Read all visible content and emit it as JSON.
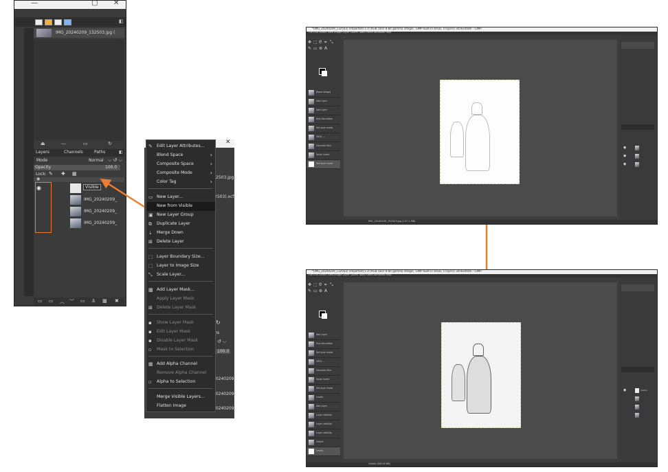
{
  "left_dock": {
    "image_name": "IMG_20240209_132503.jpg (",
    "tabs": {
      "layers": "Layers",
      "channels": "Channels",
      "paths": "Paths"
    },
    "mode_label": "Mode",
    "mode_value": "Normal",
    "opacity_label": "Opacity",
    "opacity_value": "100.0",
    "lock_label": "Lock:",
    "layers": [
      {
        "name": "Visible",
        "visible": true
      },
      {
        "name": "IMG_20240209_",
        "visible": true
      },
      {
        "name": "IMG_20240209_",
        "visible": false
      },
      {
        "name": "IMG_20240209_",
        "visible": false
      }
    ]
  },
  "bg_window": {
    "image_name": "2503.jpg (",
    "xcf_name": "2503).xcf (",
    "paths_tab": "ths",
    "opacity_value": "100.0",
    "layer_rows": [
      "20240209_",
      "20240209_",
      "20240209_"
    ]
  },
  "context_menu": {
    "items": [
      {
        "label": "Edit Layer Attributes...",
        "icon": "edit-icon",
        "disabled": false
      },
      {
        "label": "Blend Space",
        "submenu": true,
        "disabled": false
      },
      {
        "label": "Composite Space",
        "submenu": true,
        "disabled": false
      },
      {
        "label": "Composite Mode",
        "submenu": true,
        "disabled": false
      },
      {
        "label": "Color Tag",
        "submenu": true,
        "disabled": false
      },
      {
        "label": "New Layer...",
        "icon": "new-layer-icon",
        "disabled": false
      },
      {
        "label": "New from Visible",
        "disabled": false,
        "highlighted": true
      },
      {
        "label": "New Layer Group",
        "icon": "folder-icon",
        "disabled": false
      },
      {
        "label": "Duplicate Layer",
        "icon": "duplicate-icon",
        "disabled": false
      },
      {
        "label": "Merge Down",
        "icon": "merge-icon",
        "disabled": false
      },
      {
        "label": "Delete Layer",
        "icon": "delete-icon",
        "disabled": false
      },
      {
        "label": "Layer Boundary Size...",
        "icon": "boundary-icon",
        "disabled": false
      },
      {
        "label": "Layer to Image Size",
        "icon": "fit-icon",
        "disabled": false
      },
      {
        "label": "Scale Layer...",
        "icon": "scale-icon",
        "disabled": false
      },
      {
        "label": "Add Layer Mask...",
        "icon": "mask-icon",
        "disabled": false
      },
      {
        "label": "Apply Layer Mask",
        "disabled": true
      },
      {
        "label": "Delete Layer Mask",
        "icon": "delete-icon",
        "disabled": true
      },
      {
        "label": "Show Layer Mask",
        "icon": "checkbox-icon",
        "disabled": true
      },
      {
        "label": "Edit Layer Mask",
        "icon": "checkbox-icon",
        "disabled": true
      },
      {
        "label": "Disable Layer Mask",
        "icon": "checkbox-icon",
        "disabled": true
      },
      {
        "label": "Mask to Selection",
        "icon": "selection-icon",
        "disabled": true
      },
      {
        "label": "Add Alpha Channel",
        "icon": "alpha-icon",
        "disabled": false
      },
      {
        "label": "Remove Alpha Channel",
        "disabled": true
      },
      {
        "label": "Alpha to Selection",
        "icon": "selection-icon",
        "disabled": false
      },
      {
        "label": "Merge Visible Layers...",
        "disabled": false
      },
      {
        "label": "Flatten Image",
        "disabled": false
      }
    ]
  },
  "gimp_top": {
    "title": "*[IMG_20240209_132503] (imported)-1.0 (RGB color 8-bit gamma integer, GIMP built-in sRGB, 4 layers) 3456x4608 – GIMP",
    "menubar": "File  Edit  Select  View  Image  Layer  Colors  Tools  Filters  Windows  Help",
    "status": "IMG_20240209_132503.jpg (137.1 MB)",
    "history": [
      "[Base Image]",
      "Add Layer",
      "Add Layer",
      "Hue-Saturation",
      "Set layer mode",
      "GEGL ...",
      "Gaussian Blur",
      "Value Invert",
      "Set layer mode"
    ]
  },
  "gimp_bottom": {
    "title": "*[IMG_20240209_132503] (imported)-1.0 (RGB color 8-bit gamma integer, GIMP built-in sRGB, 5 layers) 3456x4608 – GIMP",
    "menubar": "File  Edit  Select  View  Image  Layer  Colors  Tools  Filters  Windows  Help",
    "status": "Visible (563.6 MB)",
    "history": [
      "Add Layer",
      "Hue-Saturation",
      "Set layer mode",
      "GEGL ...",
      "Gaussian Blur",
      "Value Invert",
      "Set layer mode",
      "Levels",
      "Add Layer",
      "Layer visibility",
      "Layer visibility",
      "Layer visibility",
      "Visible",
      "Levels"
    ],
    "top_layer": "Visible"
  },
  "colors": {
    "arrow": "#ed7d31",
    "dark_bg": "#3b3b3b",
    "canvas": "#4b4b4b"
  }
}
